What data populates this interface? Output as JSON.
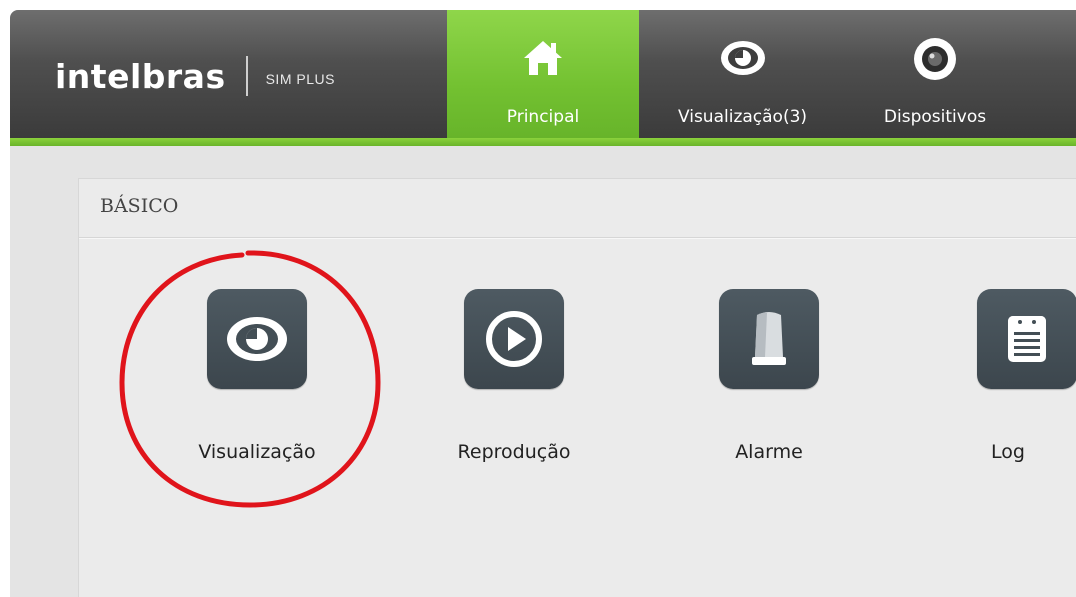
{
  "header": {
    "logo_text": "intelbras",
    "logo_subtitle": "SIM PLUS"
  },
  "nav": {
    "tabs": [
      {
        "label": "Principal",
        "icon": "home-icon",
        "active": true
      },
      {
        "label": "Visualização(3)",
        "icon": "eye-icon",
        "active": false
      },
      {
        "label": "Dispositivos",
        "icon": "camera-icon",
        "active": false
      }
    ]
  },
  "section": {
    "title": "BÁSICO",
    "items": [
      {
        "label": "Visualização",
        "icon": "eye-icon"
      },
      {
        "label": "Reprodução",
        "icon": "play-icon"
      },
      {
        "label": "Alarme",
        "icon": "siren-icon"
      },
      {
        "label": "Log",
        "icon": "log-icon"
      }
    ]
  },
  "colors": {
    "accent_green": "#73c131",
    "header_dark": "#3b3b3b",
    "tile_bg": "#434e55",
    "annotation_red": "#e0141b"
  }
}
